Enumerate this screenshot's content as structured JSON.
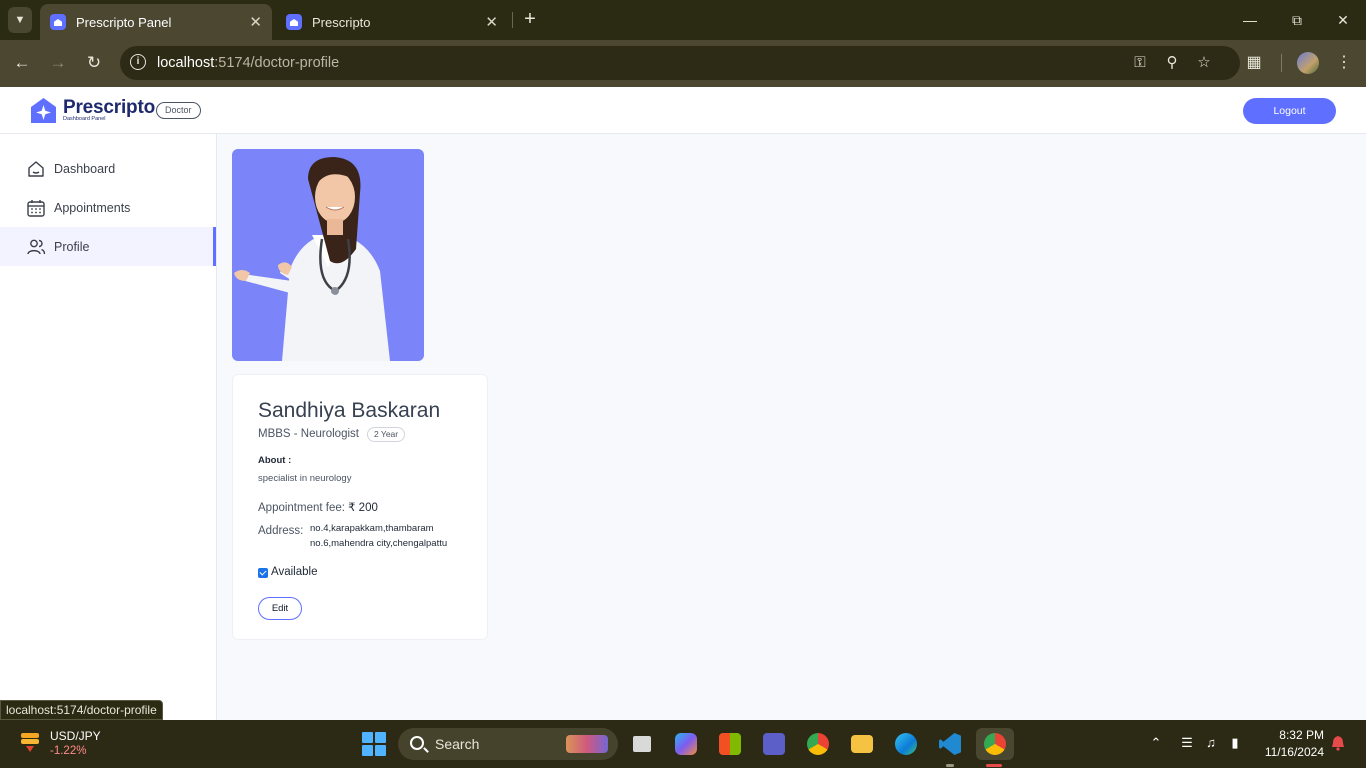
{
  "browser": {
    "tabs": [
      {
        "title": "Prescripto Panel",
        "active": true
      },
      {
        "title": "Prescripto",
        "active": false
      }
    ],
    "url_host": "localhost",
    "url_path": ":5174/doctor-profile",
    "status_url": "localhost:5174/doctor-profile"
  },
  "header": {
    "brand": "Prescripto",
    "brand_sub": "Dashboard Panel",
    "role_badge": "Doctor",
    "logout_label": "Logout",
    "accent": "#5F6FFF"
  },
  "sidebar": {
    "items": [
      {
        "label": "Dashboard",
        "icon": "home-icon",
        "active": false
      },
      {
        "label": "Appointments",
        "icon": "calendar-icon",
        "active": false
      },
      {
        "label": "Profile",
        "icon": "people-icon",
        "active": true
      }
    ]
  },
  "profile": {
    "name": "Sandhiya Baskaran",
    "degree_speciality": "MBBS - Neurologist",
    "experience": "2 Year",
    "about_label": "About :",
    "about_text": "specialist in neurology",
    "fee_label": "Appointment fee: ",
    "fee_value": "₹ 200",
    "address_label": "Address:",
    "address_line1": "no.4,karapakkam,thambaram",
    "address_line2": "no.6,mahendra city,chengalpattu",
    "available_label": "Available",
    "available": true,
    "edit_label": "Edit"
  },
  "taskbar": {
    "widget_title": "USD/JPY",
    "widget_value": "-1.22%",
    "search_label": "Search",
    "time": "8:32 PM",
    "date": "11/16/2024"
  }
}
